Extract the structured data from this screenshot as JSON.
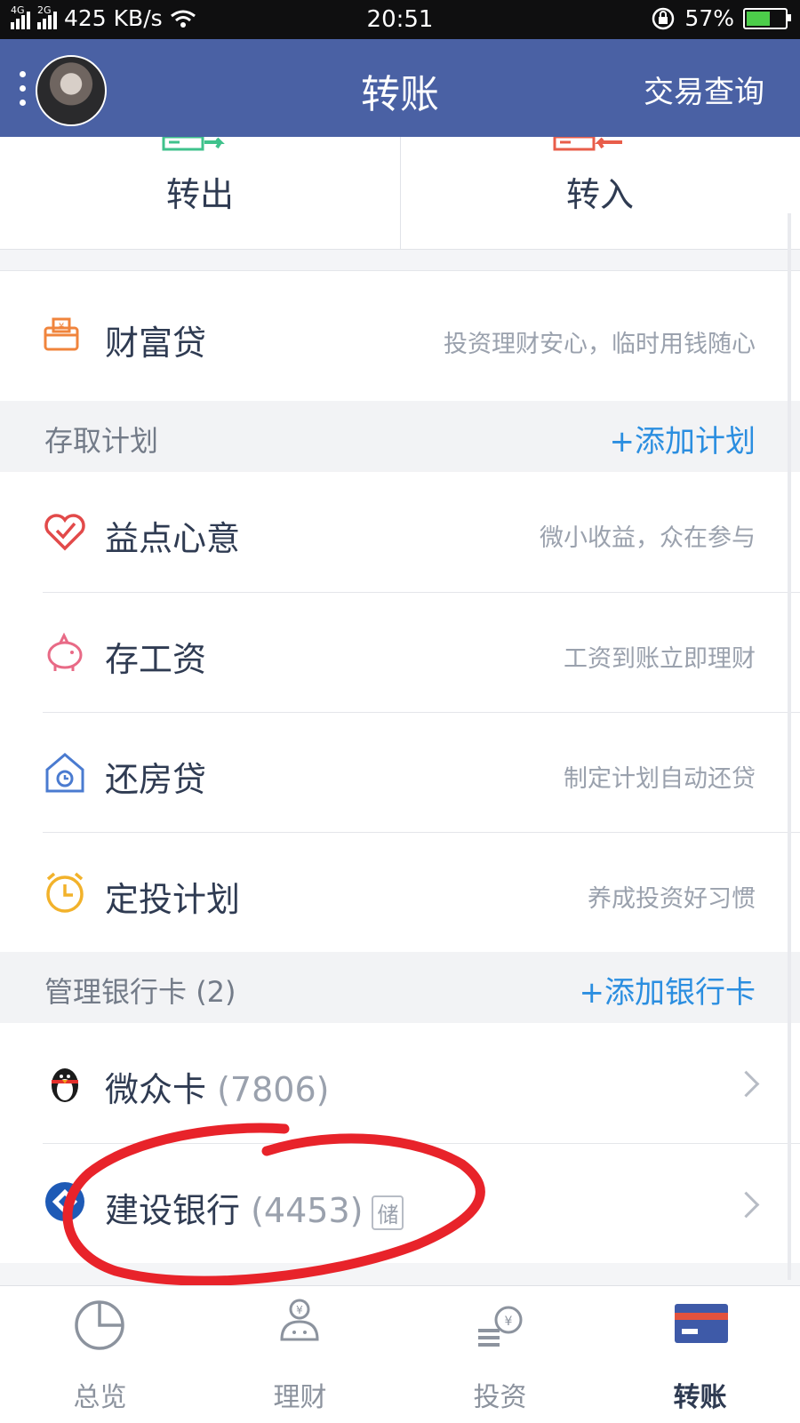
{
  "status_bar": {
    "network_left": "4G",
    "network_right": "2G",
    "speed": "425 KB/s",
    "time": "20:51",
    "battery": "57%"
  },
  "nav": {
    "title": "转账",
    "right_action": "交易查询"
  },
  "transfer": {
    "out_label": "转出",
    "in_label": "转入"
  },
  "wealth_loan": {
    "title": "财富贷",
    "desc": "投资理财安心，临时用钱随心"
  },
  "plans": {
    "header": "存取计划",
    "add_label": "+添加计划",
    "items": [
      {
        "title": "益点心意",
        "desc": "微小收益，众在参与",
        "icon": "heart-check-icon"
      },
      {
        "title": "存工资",
        "desc": "工资到账立即理财",
        "icon": "piggy-bank-icon"
      },
      {
        "title": "还房贷",
        "desc": "制定计划自动还贷",
        "icon": "house-clock-icon"
      },
      {
        "title": "定投计划",
        "desc": "养成投资好习惯",
        "icon": "alarm-clock-icon"
      }
    ]
  },
  "cards": {
    "header": "管理银行卡",
    "count": "(2)",
    "add_label": "+添加银行卡",
    "items": [
      {
        "name": "微众卡",
        "number": "(7806)",
        "badge": "",
        "icon": "penguin-icon"
      },
      {
        "name": "建设银行",
        "number": "(4453)",
        "badge": "储",
        "icon": "ccb-bank-icon"
      }
    ]
  },
  "tabs": [
    {
      "label": "总览",
      "icon": "pie-chart-icon",
      "active": false
    },
    {
      "label": "理财",
      "icon": "money-bag-icon",
      "active": false
    },
    {
      "label": "投资",
      "icon": "coins-icon",
      "active": false
    },
    {
      "label": "转账",
      "icon": "transfer-card-icon",
      "active": true
    }
  ],
  "colors": {
    "nav": "#4a61a4",
    "accent": "#2b8ee0",
    "annotation": "#e8232a"
  }
}
